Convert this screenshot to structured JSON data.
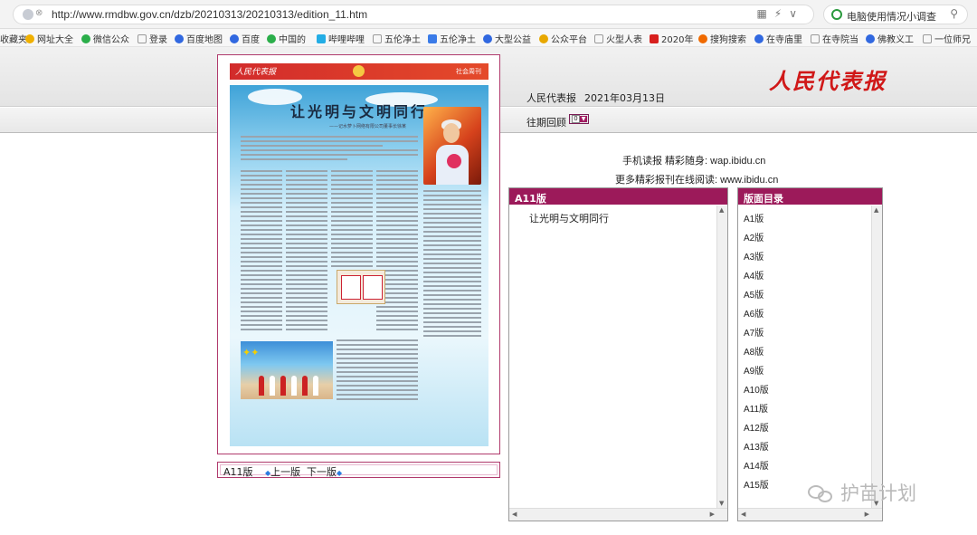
{
  "browser": {
    "url": "http://www.rmdbw.gov.cn/dzb/20210313/20210313/edition_11.htm",
    "search_text": "电脑使用情况小调查",
    "bookmarks": [
      "收藏夹",
      "网址大全",
      "微信公众",
      "登录",
      "百度地图",
      "百度",
      "中国的",
      "哔哩哔哩",
      "五伦净土",
      "五伦净土",
      "大型公益",
      "公众平台",
      "火型人表",
      "2020年",
      "搜狗搜索",
      "在寺庙里",
      "在寺院当",
      "佛教义工",
      "一位师兄"
    ]
  },
  "header": {
    "logo_text": "人民代表报",
    "name": "人民代表报",
    "date": "2021年03月13日",
    "archive_label": "往期回顾",
    "archive_select": "0"
  },
  "paper": {
    "masthead": "人民代表报",
    "page_label": "社会周刊",
    "headline": "让光明与文明同行",
    "subheadline": "——记水萝卜网络有限公司董事长徐某"
  },
  "pager": {
    "edition": "A11版",
    "prev": "上一版",
    "next": "下一版"
  },
  "info": {
    "mobile": "手机读报 精彩随身: wap.ibidu.cn",
    "more": "更多精彩报刊在线阅读: www.ibidu.cn"
  },
  "articles_panel": {
    "title": "A11版",
    "items": [
      "让光明与文明同行"
    ]
  },
  "editions_panel": {
    "title": "版面目录",
    "items": [
      "A1版",
      "A2版",
      "A3版",
      "A4版",
      "A5版",
      "A6版",
      "A7版",
      "A8版",
      "A9版",
      "A10版",
      "A11版",
      "A12版",
      "A13版",
      "A14版",
      "A15版"
    ]
  },
  "watermark": "护苗计划",
  "colors": {
    "accent": "#9c1a5a",
    "logo": "#d01818"
  }
}
